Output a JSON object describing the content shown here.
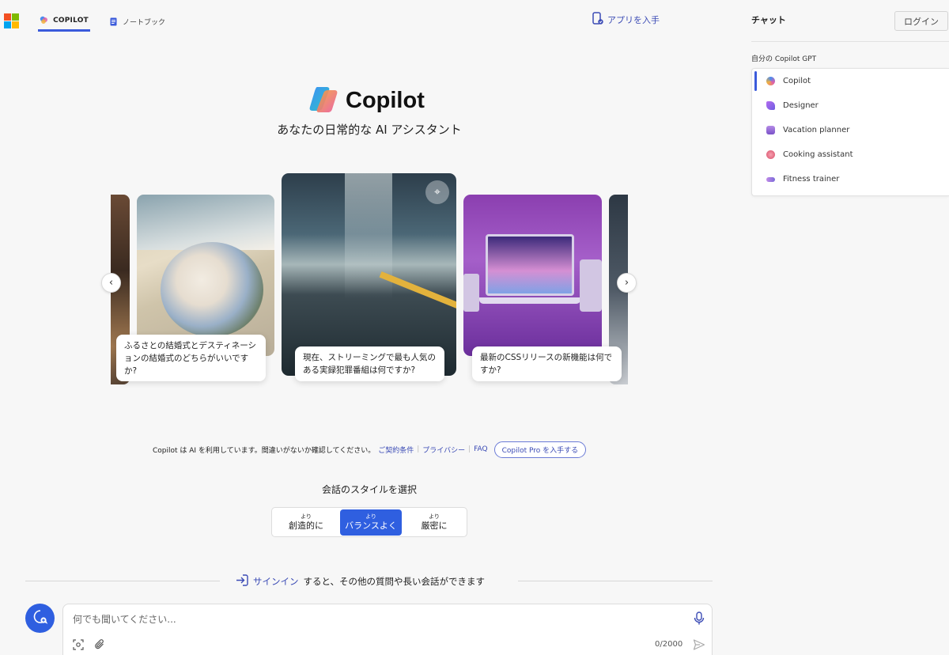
{
  "header": {
    "tabs": [
      {
        "label": "COPILOT",
        "active": true
      },
      {
        "label": "ノートブック",
        "active": false
      }
    ],
    "get_app": "アプリを入手"
  },
  "right_panel": {
    "title": "チャット",
    "login": "ログイン",
    "section_label": "自分の Copilot GPT",
    "gpts": [
      {
        "label": "Copilot",
        "icon": "copilot-icon",
        "active": true
      },
      {
        "label": "Designer",
        "icon": "designer-icon"
      },
      {
        "label": "Vacation planner",
        "icon": "vacation-icon"
      },
      {
        "label": "Cooking assistant",
        "icon": "cooking-icon"
      },
      {
        "label": "Fitness trainer",
        "icon": "fitness-icon"
      }
    ]
  },
  "hero": {
    "brand": "Copilot",
    "subtitle": "あなたの日常的な AI アシスタント"
  },
  "carousel": {
    "cards": [
      {
        "caption": "ふるさとの結婚式とデスティネーションの結婚式のどちらがいいですか?"
      },
      {
        "caption": "現在、ストリーミングで最も人気のある実録犯罪番組は何ですか?"
      },
      {
        "caption": "最新のCSSリリースの新機能は何ですか?"
      }
    ]
  },
  "disclaimer": {
    "text": "Copilot は AI を利用しています。間違いがないか確認してください。",
    "terms": "ご契約条件",
    "privacy": "プライバシー",
    "faq": "FAQ",
    "pro": "Copilot Pro を入手する"
  },
  "style_selector": {
    "title": "会話のスタイルを選択",
    "options": [
      {
        "top": "より",
        "label": "創造的に",
        "selected": false
      },
      {
        "top": "より",
        "label": "バランスよく",
        "selected": true
      },
      {
        "top": "より",
        "label": "厳密に",
        "selected": false
      }
    ]
  },
  "signin": {
    "link": "サインイン",
    "rest": "すると、その他の質問や長い会話ができます"
  },
  "composer": {
    "placeholder": "何でも聞いてください...",
    "counter": "0/2000"
  },
  "colors": {
    "accent": "#2f5fe0",
    "link": "#3b4bb5"
  }
}
